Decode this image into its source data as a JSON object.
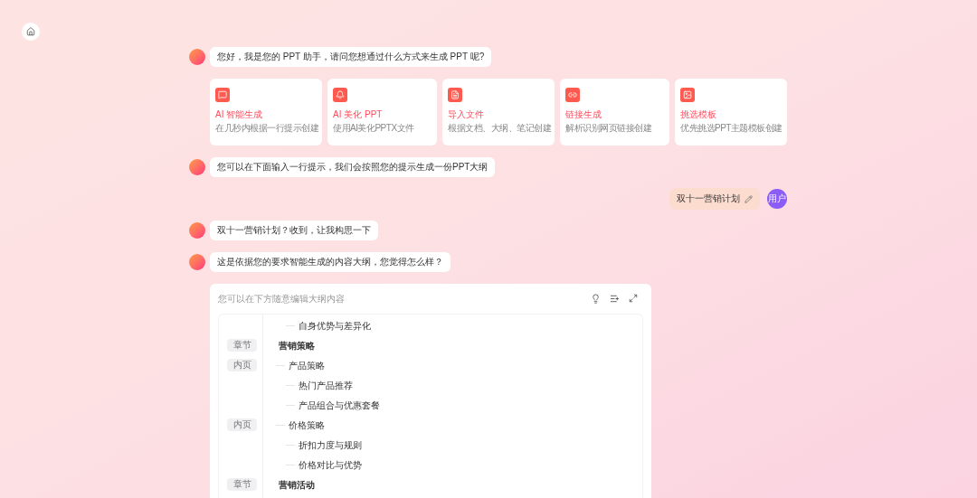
{
  "greeting": "您好，我是您的 PPT 助手，请问您想通过什么方式来生成 PPT 呢?",
  "options": [
    {
      "kind": "chat",
      "title": "AI 智能生成",
      "desc": "在几秒内根据一行提示创建"
    },
    {
      "kind": "beautify",
      "title": "AI 美化 PPT",
      "desc": "使用AI美化PPTX文件"
    },
    {
      "kind": "file",
      "title": "导入文件",
      "desc": "根据文档、大纲、笔记创建"
    },
    {
      "kind": "link",
      "title": "链接生成",
      "desc": "解析识别网页链接创建"
    },
    {
      "kind": "template",
      "title": "挑选模板",
      "desc": "优先挑选PPT主题模板创建"
    }
  ],
  "messages": [
    {
      "kind": "assistant",
      "text": "您可以在下面输入一行提示，我们会按照您的提示生成一份PPT大纲"
    },
    {
      "kind": "user",
      "text": "双十一营销计划",
      "avatar": "用户"
    },
    {
      "kind": "assistant",
      "text": "双十一营销计划？收到，让我构思一下"
    },
    {
      "kind": "assistant",
      "text": "这是依据您的要求智能生成的内容大纲，您觉得怎么样？"
    }
  ],
  "outline": {
    "hint": "您可以在下方随意编辑大纲内容",
    "rows": [
      {
        "kind": "item",
        "text": "自身优势与差异化"
      },
      {
        "kind": "chapter",
        "tag": "章节",
        "text": "营销策略",
        "children": [
          {
            "kind": "page",
            "tag": "内页",
            "text": "产品策略",
            "children": [
              {
                "kind": "item",
                "text": "热门产品推荐"
              },
              {
                "kind": "item",
                "text": "产品组合与优惠套餐"
              }
            ]
          },
          {
            "kind": "page",
            "tag": "内页",
            "text": "价格策略",
            "children": [
              {
                "kind": "item",
                "text": "折扣力度与规则"
              },
              {
                "kind": "item",
                "text": "价格对比与优势"
              }
            ]
          }
        ]
      },
      {
        "kind": "chapter",
        "tag": "章节",
        "text": "营销活动"
      }
    ]
  }
}
